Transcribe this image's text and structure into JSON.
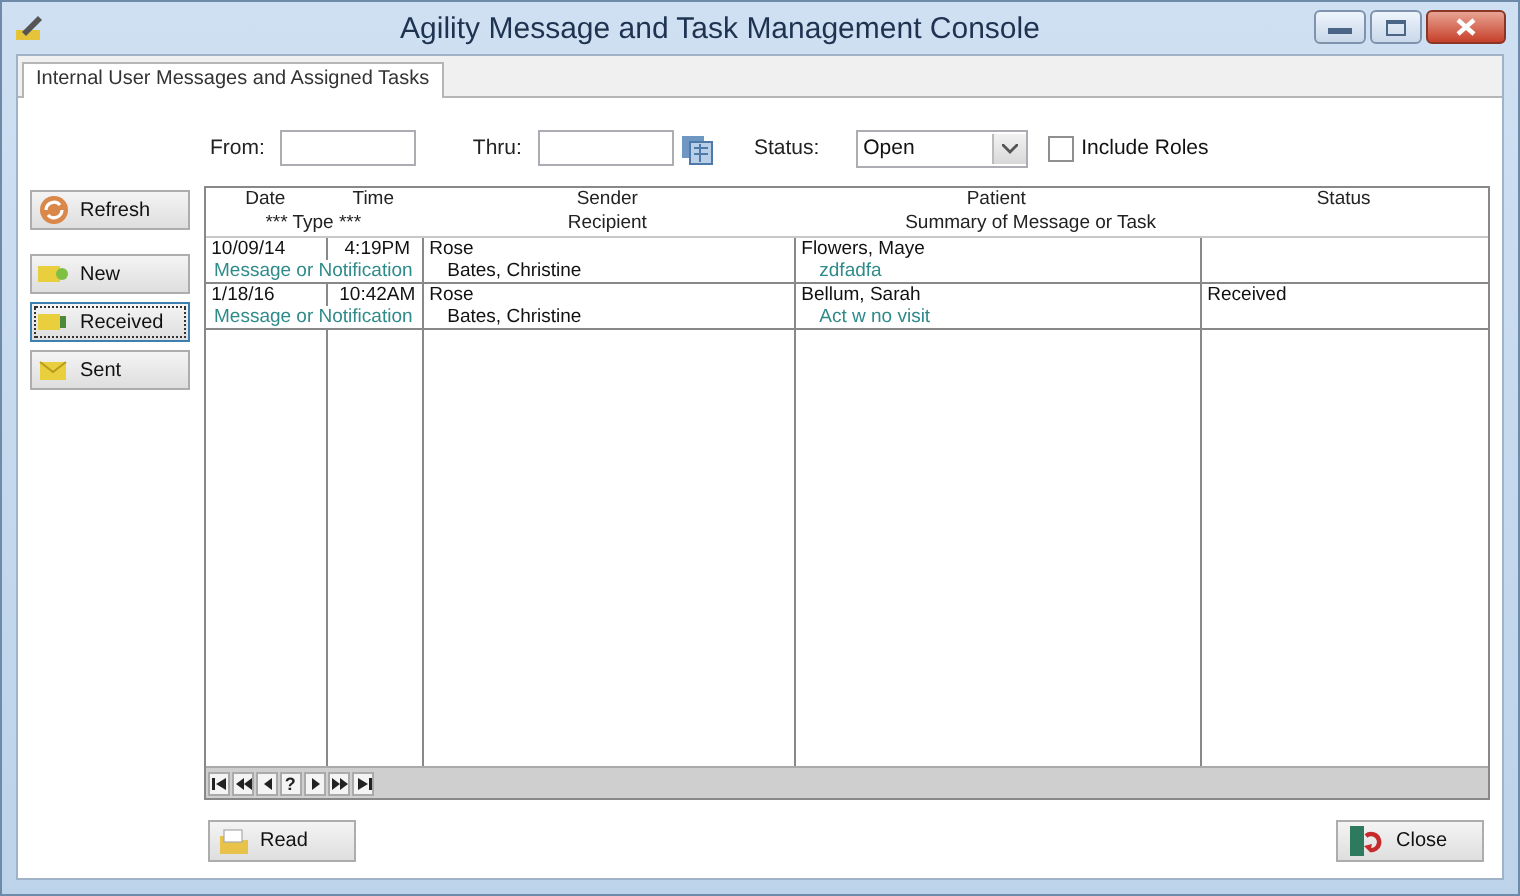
{
  "window": {
    "title": "Agility Message and Task Management Console"
  },
  "tabs": [
    {
      "label": "Internal User Messages and Assigned Tasks",
      "selected": true
    }
  ],
  "filters": {
    "from_label": "From:",
    "thru_label": "Thru:",
    "status_label": "Status:",
    "status_value": "Open",
    "include_roles": {
      "label": "Include Roles",
      "checked": false
    }
  },
  "side_buttons": [
    {
      "label": "Refresh",
      "kind": "refresh",
      "focused": false
    },
    {
      "label": "New",
      "kind": "new",
      "focused": false
    },
    {
      "label": "Received",
      "kind": "received",
      "focused": true
    },
    {
      "label": "Sent",
      "kind": "sent",
      "focused": false
    }
  ],
  "table": {
    "columns": [
      "Date",
      "Time",
      "Sender",
      "Patient",
      "Status"
    ],
    "subcolumns": [
      "*** Type ***",
      "Recipient",
      "Summary of Message or Task"
    ],
    "rows": [
      {
        "date": "10/09/14",
        "time": "4:19PM",
        "sender": "Rose",
        "patient": "Flowers, Maye",
        "type": "Message or Notification",
        "recipient": "Bates, Christine",
        "summary": "zdfadfa"
      },
      {
        "date": "1/18/16",
        "time": "10:42AM",
        "sender": "Rose",
        "patient": "Bellum, Sarah",
        "status": "Received",
        "type": "Message or Notification",
        "recipient": "Bates, Christine",
        "summary": "Act w no visit"
      }
    ]
  },
  "navigator": [
    {
      "kind": "first"
    },
    {
      "kind": "prev_page"
    },
    {
      "kind": "prev"
    },
    {
      "kind": "help",
      "label": "?"
    },
    {
      "kind": "next"
    },
    {
      "kind": "next_page"
    },
    {
      "kind": "last"
    }
  ],
  "footer_buttons": [
    {
      "label": "Read",
      "kind": "read"
    },
    {
      "label": "Close",
      "kind": "close"
    }
  ]
}
